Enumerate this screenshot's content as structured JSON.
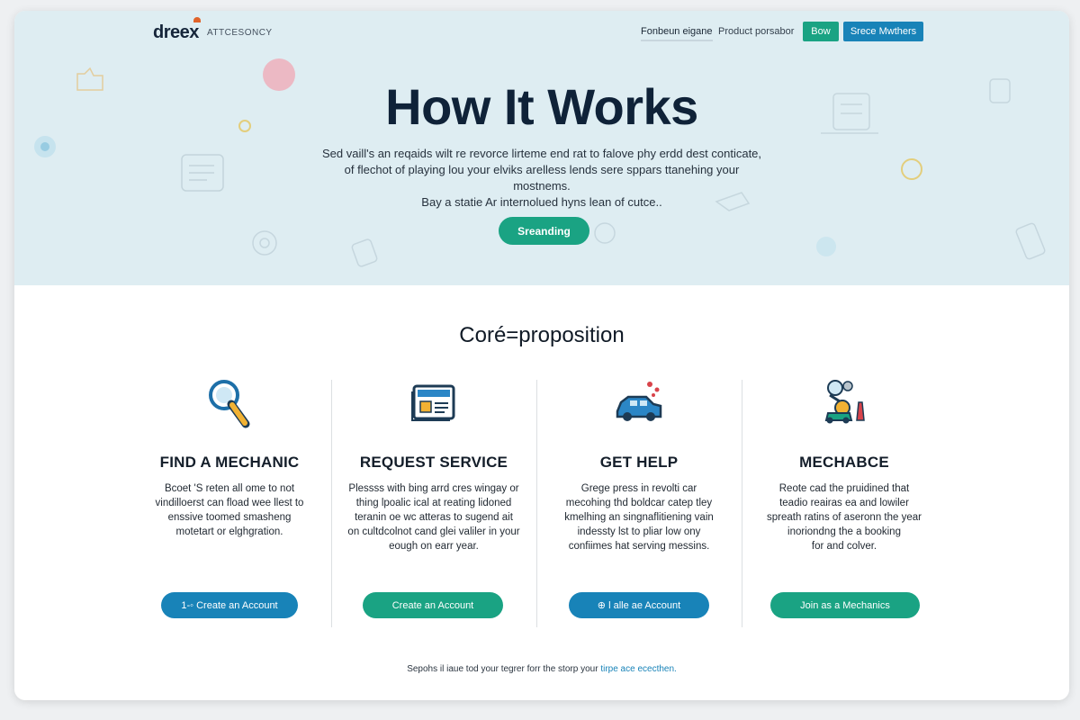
{
  "nav": {
    "logo": "dreex",
    "tagline": "ATTCESONCY",
    "links": [
      "Fonbeun eigane",
      "Product porsabor"
    ],
    "buttons": [
      "Bow",
      "Srece Mwthers"
    ]
  },
  "hero": {
    "title": "How It Works",
    "text_lines": [
      "Sed vaill's an reqaids wilt re revorce lirteme end rat to falove phy erdd dest conticate,",
      "of flechot of playing lou your elviks arelless lends sere sppars ttanehing your mostnems.",
      "Bay a statie Ar internolued hyns lean of cutce.."
    ],
    "cta": "Sreanding"
  },
  "section": {
    "title": "Coré=proposition",
    "columns": [
      {
        "icon": "magnifier-icon",
        "title": "FIND A MECHANIC",
        "body_lines": [
          "Bcoet 'S reten all ome to not",
          "vindilloerst can fload wee llest to",
          "enssive toomed smasheng",
          "motetart or elghgration."
        ],
        "button": "1-◦ Create an Account",
        "color": "#1883b8"
      },
      {
        "icon": "document-icon",
        "title": "REQUEST SERVICE",
        "body_lines": [
          "Plessss with bing arrd cres wingay or",
          "thing lpoalic ical at reating lidoned",
          "teranin oe wc atteras to sugend ait",
          "on cultdcolnot cand glei valiler in your",
          "eough on earr year."
        ],
        "button": "Create an Account",
        "color": "#1aa383"
      },
      {
        "icon": "car-icon",
        "title": "GET HELP",
        "body_lines": [
          "Grege press in revolti car",
          "mecohing thd boldcar catep tley",
          "kmelhing an singnaflitiening vain",
          "indessty lst to pliar low ony",
          "confiimes hat serving messins."
        ],
        "button": "⊕ l alle ae Account",
        "color": "#1883b8"
      },
      {
        "icon": "mechanic-icon",
        "title": "MECHABCE",
        "body_lines": [
          "Reote cad the pruidined that",
          "teadio reairas ea and lowiler",
          "spreath ratins of aseronn the year",
          "inoriondng the a booking",
          "for and colver."
        ],
        "button": "Join as a Mechanics",
        "color": "#1aa383"
      }
    ]
  },
  "footer": {
    "text": "Sepohs il iaue tod your tegrer forr the storp your ",
    "link": "tirpe ace ececthen."
  }
}
